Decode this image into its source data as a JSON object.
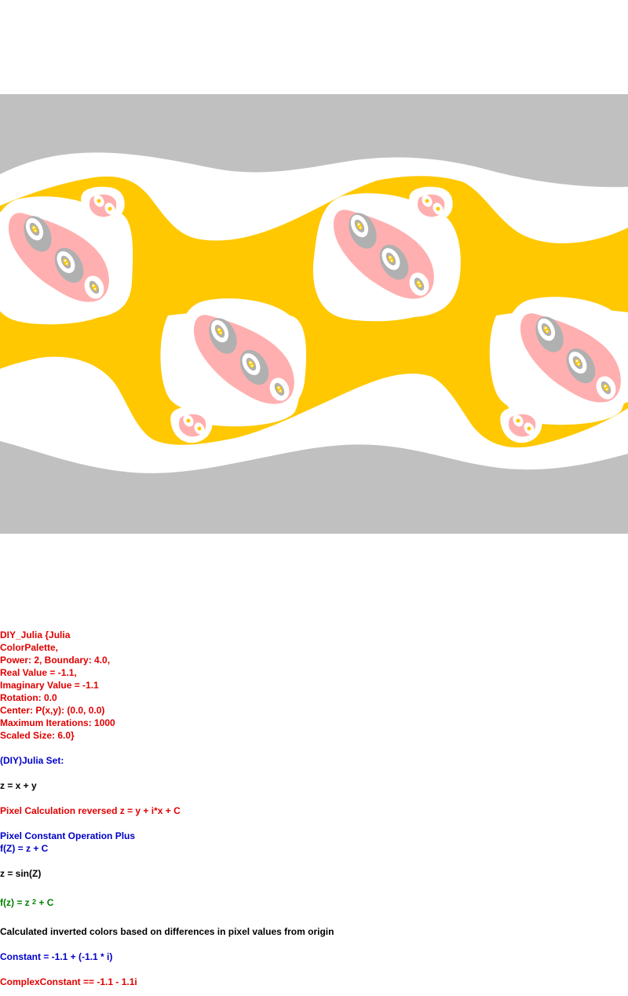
{
  "image": {
    "subject": "DIY Julia set fractal render",
    "colors": {
      "band": "#c0c0c0",
      "background": "#ffffff",
      "main_body": "#ffc800",
      "pink": "#ffafaf",
      "gray_core": "#b0b0b0",
      "gold": "#ffc800"
    }
  },
  "params": {
    "title": "DIY_Julia {Julia",
    "palette": "ColorPalette,",
    "power_boundary": "Power: 2, Boundary: 4.0,",
    "real_value": "Real Value = -1.1,",
    "imaginary_value": "Imaginary Value = -1.1",
    "rotation": "Rotation: 0.0",
    "center": "Center: P(x,y): (0.0, 0.0)",
    "max_iterations": "Maximum Iterations: 1000",
    "scaled_size": "Scaled Size: 6.0}",
    "set_name": "(DIY)Julia Set:",
    "z_def": "z = x + y",
    "pixel_calc": "Pixel Calculation reversed z = y + i*x + C",
    "constant_op": "Pixel Constant Operation Plus",
    "fz_def": "f(Z) = z + C",
    "z_sin": "z = sin(Z)",
    "formula_lhs": "f(z) = z",
    "formula_exp": "2",
    "formula_rhs": " + C",
    "inverted_colors": "Calculated inverted colors based on differences in pixel values from origin",
    "constant": "Constant = -1.1 + (-1.1 * i)",
    "complex_constant": "ComplexConstant == -1.1 - 1.1i"
  }
}
